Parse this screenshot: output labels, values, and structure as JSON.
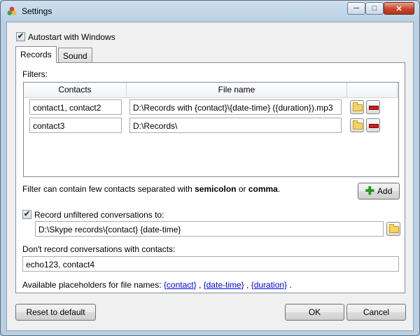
{
  "window": {
    "title": "Settings",
    "minimize": "─",
    "maximize": "□",
    "close": "✕"
  },
  "general": {
    "autostart_label": "Autostart with Windows",
    "autostart_checked": true
  },
  "tabs": [
    {
      "label": "Records",
      "active": true
    },
    {
      "label": "Sound",
      "active": false
    }
  ],
  "records": {
    "filters_label": "Filters:",
    "columns": {
      "contacts": "Contacts",
      "file_name": "File name"
    },
    "rows": [
      {
        "contacts": "contact1, contact2",
        "file_name": "D:\\Records with {contact}\\{date-time} ({duration}).mp3"
      },
      {
        "contacts": "contact3",
        "file_name": "D:\\Records\\"
      }
    ],
    "hint_prefix": "Filter can contain few contacts separated with ",
    "hint_bold1": "semicolon",
    "hint_mid": " or ",
    "hint_bold2": "comma",
    "hint_suffix": ".",
    "add_label": "Add",
    "unfiltered_label": "Record unfiltered conversations to:",
    "unfiltered_checked": true,
    "unfiltered_path": "D:\\Skype records\\{contact} {date-time}",
    "dont_record_label": "Don't record conversations with contacts:",
    "dont_record_value": "echo123, contact4",
    "placeholders_prefix": "Available placeholders for file names: ",
    "placeholders": [
      "{contact}",
      "{date-time}",
      "{duration}"
    ],
    "sep": " , ",
    "end": " ."
  },
  "footer": {
    "reset_label": "Reset to default",
    "ok_label": "OK",
    "cancel_label": "Cancel"
  }
}
